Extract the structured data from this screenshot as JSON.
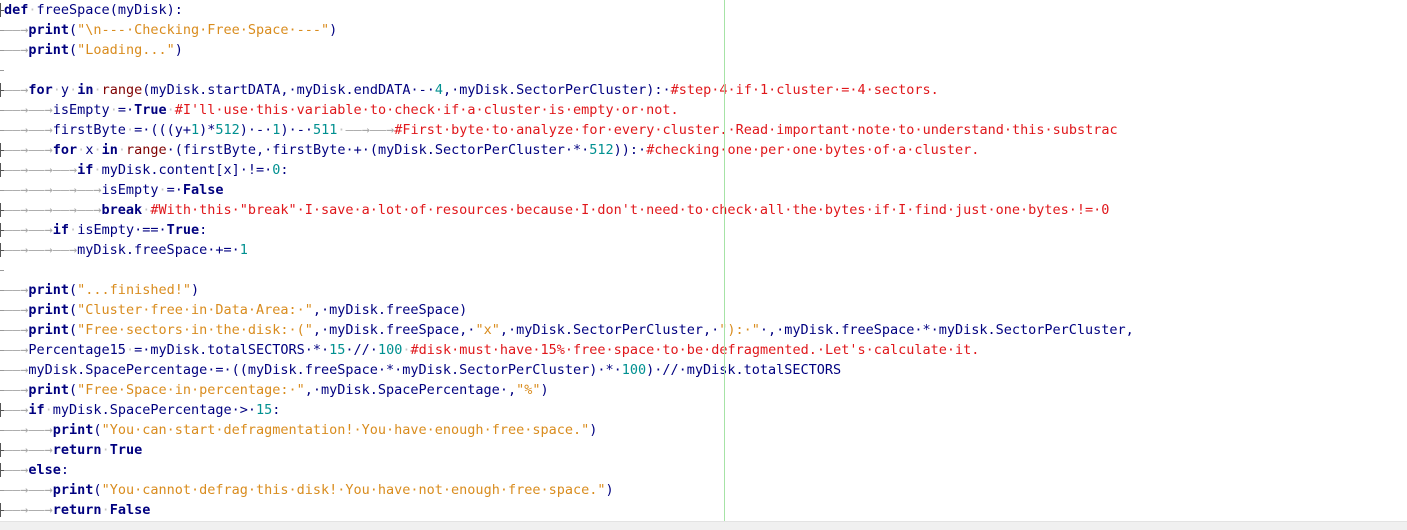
{
  "editor": {
    "language": "python",
    "colors": {
      "background": "#ffffff",
      "keyword": "#00007f",
      "builtin": "#7f0000",
      "string": "#d98c1e",
      "number": "#009090",
      "comment": "#e0171b",
      "identifier": "#000080",
      "whitespace_marker": "#a8a8a8",
      "edge_guide": "#a6e3a6"
    },
    "icons": {
      "fold_marker": "fold-marker-icon",
      "tab_arrow": "tab-arrow-icon"
    },
    "lines": [
      {
        "fold": "fold-start",
        "tokens": [
          {
            "t": "kw",
            "v": "def"
          },
          {
            "t": "ws",
            "v": "·"
          },
          {
            "t": "id",
            "v": "freeSpace"
          },
          {
            "t": "op",
            "v": "(myDisk):"
          }
        ]
      },
      {
        "fold": "fold-line",
        "tokens": [
          {
            "t": "tab",
            "v": "——→"
          },
          {
            "t": "kw",
            "v": "print"
          },
          {
            "t": "op",
            "v": "("
          },
          {
            "t": "str",
            "v": "\"\\n---·Checking·Free·Space·---\""
          },
          {
            "t": "op",
            "v": ")"
          }
        ]
      },
      {
        "fold": "fold-line",
        "tokens": [
          {
            "t": "tab",
            "v": "——→"
          },
          {
            "t": "kw",
            "v": "print"
          },
          {
            "t": "op",
            "v": "("
          },
          {
            "t": "str",
            "v": "\"Loading...\""
          },
          {
            "t": "op",
            "v": ")"
          }
        ]
      },
      {
        "fold": "fold-line",
        "tokens": []
      },
      {
        "fold": "fold-sub",
        "tokens": [
          {
            "t": "tab",
            "v": "——→"
          },
          {
            "t": "kw",
            "v": "for"
          },
          {
            "t": "ws",
            "v": "·"
          },
          {
            "t": "id",
            "v": "y"
          },
          {
            "t": "ws",
            "v": "·"
          },
          {
            "t": "kw",
            "v": "in"
          },
          {
            "t": "ws",
            "v": "·"
          },
          {
            "t": "bi",
            "v": "range"
          },
          {
            "t": "op",
            "v": "(myDisk.startDATA,·myDisk.endDATA·-·"
          },
          {
            "t": "num",
            "v": "4"
          },
          {
            "t": "op",
            "v": ",·myDisk.SectorPerCluster):·"
          },
          {
            "t": "cmt",
            "v": "#step·4·if·1·cluster·=·4·sectors."
          }
        ]
      },
      {
        "fold": "fold-line",
        "tokens": [
          {
            "t": "tab",
            "v": "——→——→"
          },
          {
            "t": "id",
            "v": "isEmpty"
          },
          {
            "t": "ws",
            "v": "·"
          },
          {
            "t": "op",
            "v": "=·"
          },
          {
            "t": "kw",
            "v": "True"
          },
          {
            "t": "ws",
            "v": "·"
          },
          {
            "t": "cmt",
            "v": "#I'll·use·this·variable·to·check·if·a·cluster·is·empty·or·not."
          }
        ]
      },
      {
        "fold": "fold-line",
        "tokens": [
          {
            "t": "tab",
            "v": "——→——→"
          },
          {
            "t": "id",
            "v": "firstByte"
          },
          {
            "t": "ws",
            "v": "·"
          },
          {
            "t": "op",
            "v": "=·(((y+"
          },
          {
            "t": "num",
            "v": "1"
          },
          {
            "t": "op",
            "v": ")*"
          },
          {
            "t": "num",
            "v": "512"
          },
          {
            "t": "op",
            "v": ")·-·"
          },
          {
            "t": "num",
            "v": "1"
          },
          {
            "t": "op",
            "v": ")·-·"
          },
          {
            "t": "num",
            "v": "511"
          },
          {
            "t": "ws",
            "v": "·"
          },
          {
            "t": "tab",
            "v": "——→——→"
          },
          {
            "t": "cmt",
            "v": "#First·byte·to·analyze·for·every·cluster.·Read·important·note·to·understand·this·substrac"
          }
        ]
      },
      {
        "fold": "fold-sub",
        "tokens": [
          {
            "t": "tab",
            "v": "——→——→"
          },
          {
            "t": "kw",
            "v": "for"
          },
          {
            "t": "ws",
            "v": "·"
          },
          {
            "t": "id",
            "v": "x"
          },
          {
            "t": "ws",
            "v": "·"
          },
          {
            "t": "kw",
            "v": "in"
          },
          {
            "t": "ws",
            "v": "·"
          },
          {
            "t": "bi",
            "v": "range"
          },
          {
            "t": "op",
            "v": "·(firstByte,·firstByte·+·(myDisk.SectorPerCluster·*·"
          },
          {
            "t": "num",
            "v": "512"
          },
          {
            "t": "op",
            "v": ")):·"
          },
          {
            "t": "cmt",
            "v": "#checking·one·per·one·bytes·of·a·cluster."
          }
        ]
      },
      {
        "fold": "fold-sub",
        "tokens": [
          {
            "t": "tab",
            "v": "——→——→——→"
          },
          {
            "t": "kw",
            "v": "if"
          },
          {
            "t": "ws",
            "v": "·"
          },
          {
            "t": "op",
            "v": "myDisk.content[x]·!=·"
          },
          {
            "t": "num",
            "v": "0"
          },
          {
            "t": "op",
            "v": ":"
          }
        ]
      },
      {
        "fold": "fold-line",
        "tokens": [
          {
            "t": "tab",
            "v": "——→——→——→——→"
          },
          {
            "t": "id",
            "v": "isEmpty"
          },
          {
            "t": "ws",
            "v": "·"
          },
          {
            "t": "op",
            "v": "=·"
          },
          {
            "t": "kw",
            "v": "False"
          }
        ]
      },
      {
        "fold": "fold-end",
        "tokens": [
          {
            "t": "tab",
            "v": "——→——→——→——→"
          },
          {
            "t": "kw",
            "v": "break"
          },
          {
            "t": "ws",
            "v": "·"
          },
          {
            "t": "cmt",
            "v": "#With·this·\"break\"·I·save·a·lot·of·resources·because·I·don't·need·to·check·all·the·bytes·if·I·find·just·one·bytes·!=·0"
          }
        ]
      },
      {
        "fold": "fold-sub",
        "tokens": [
          {
            "t": "tab",
            "v": "——→——→"
          },
          {
            "t": "kw",
            "v": "if"
          },
          {
            "t": "ws",
            "v": "·"
          },
          {
            "t": "op",
            "v": "isEmpty·==·"
          },
          {
            "t": "kw",
            "v": "True"
          },
          {
            "t": "op",
            "v": ":"
          }
        ]
      },
      {
        "fold": "fold-end",
        "tokens": [
          {
            "t": "tab",
            "v": "——→——→——→"
          },
          {
            "t": "op",
            "v": "myDisk.freeSpace·+=·"
          },
          {
            "t": "num",
            "v": "1"
          }
        ]
      },
      {
        "fold": "fold-line",
        "tokens": []
      },
      {
        "fold": "fold-line",
        "tokens": [
          {
            "t": "tab",
            "v": "——→"
          },
          {
            "t": "kw",
            "v": "print"
          },
          {
            "t": "op",
            "v": "("
          },
          {
            "t": "str",
            "v": "\"...finished!\""
          },
          {
            "t": "op",
            "v": ")"
          }
        ]
      },
      {
        "fold": "fold-line",
        "tokens": [
          {
            "t": "tab",
            "v": "——→"
          },
          {
            "t": "kw",
            "v": "print"
          },
          {
            "t": "op",
            "v": "("
          },
          {
            "t": "str",
            "v": "\"Cluster·free·in·Data·Area:·\""
          },
          {
            "t": "op",
            "v": ",·myDisk.freeSpace)"
          }
        ]
      },
      {
        "fold": "fold-line",
        "tokens": [
          {
            "t": "tab",
            "v": "——→"
          },
          {
            "t": "kw",
            "v": "print"
          },
          {
            "t": "op",
            "v": "("
          },
          {
            "t": "str",
            "v": "\"Free·sectors·in·the·disk:·(\""
          },
          {
            "t": "op",
            "v": ",·myDisk.freeSpace,·"
          },
          {
            "t": "str",
            "v": "\"x\""
          },
          {
            "t": "op",
            "v": ",·myDisk.SectorPerCluster,·"
          },
          {
            "t": "str",
            "v": "\"):·\""
          },
          {
            "t": "op",
            "v": "·,·myDisk.freeSpace·*·myDisk.SectorPerCluster,"
          }
        ]
      },
      {
        "fold": "fold-line",
        "tokens": [
          {
            "t": "tab",
            "v": "——→"
          },
          {
            "t": "id",
            "v": "Percentage15"
          },
          {
            "t": "ws",
            "v": "·"
          },
          {
            "t": "op",
            "v": "=·myDisk.totalSECTORS·*·"
          },
          {
            "t": "num",
            "v": "15"
          },
          {
            "t": "op",
            "v": "·//·"
          },
          {
            "t": "num",
            "v": "100"
          },
          {
            "t": "ws",
            "v": "·"
          },
          {
            "t": "cmt",
            "v": "#disk·must·have·15%·free·space·to·be·defragmented.·Let's·calculate·it."
          }
        ]
      },
      {
        "fold": "fold-line",
        "tokens": [
          {
            "t": "tab",
            "v": "——→"
          },
          {
            "t": "op",
            "v": "myDisk.SpacePercentage·=·((myDisk.freeSpace·*·myDisk.SectorPerCluster)·*·"
          },
          {
            "t": "num",
            "v": "100"
          },
          {
            "t": "op",
            "v": ")·//·myDisk.totalSECTORS"
          }
        ]
      },
      {
        "fold": "fold-line",
        "tokens": [
          {
            "t": "tab",
            "v": "——→"
          },
          {
            "t": "kw",
            "v": "print"
          },
          {
            "t": "op",
            "v": "("
          },
          {
            "t": "str",
            "v": "\"Free·Space·in·percentage:·\""
          },
          {
            "t": "op",
            "v": ",·myDisk.SpacePercentage·,"
          },
          {
            "t": "str",
            "v": "\"%\""
          },
          {
            "t": "op",
            "v": ")"
          }
        ]
      },
      {
        "fold": "fold-sub",
        "tokens": [
          {
            "t": "tab",
            "v": "——→"
          },
          {
            "t": "kw",
            "v": "if"
          },
          {
            "t": "ws",
            "v": "·"
          },
          {
            "t": "op",
            "v": "myDisk.SpacePercentage·>·"
          },
          {
            "t": "num",
            "v": "15"
          },
          {
            "t": "op",
            "v": ":"
          }
        ]
      },
      {
        "fold": "fold-line",
        "tokens": [
          {
            "t": "tab",
            "v": "——→——→"
          },
          {
            "t": "kw",
            "v": "print"
          },
          {
            "t": "op",
            "v": "("
          },
          {
            "t": "str",
            "v": "\"You·can·start·defragmentation!·You·have·enough·free·space.\""
          },
          {
            "t": "op",
            "v": ")"
          }
        ]
      },
      {
        "fold": "fold-end",
        "tokens": [
          {
            "t": "tab",
            "v": "——→——→"
          },
          {
            "t": "kw",
            "v": "return"
          },
          {
            "t": "ws",
            "v": "·"
          },
          {
            "t": "kw",
            "v": "True"
          }
        ]
      },
      {
        "fold": "fold-sub",
        "tokens": [
          {
            "t": "tab",
            "v": "——→"
          },
          {
            "t": "kw",
            "v": "else"
          },
          {
            "t": "op",
            "v": ":"
          }
        ]
      },
      {
        "fold": "fold-line",
        "tokens": [
          {
            "t": "tab",
            "v": "——→——→"
          },
          {
            "t": "kw",
            "v": "print"
          },
          {
            "t": "op",
            "v": "("
          },
          {
            "t": "str",
            "v": "\"You·cannot·defrag·this·disk!·You·have·not·enough·free·space.\""
          },
          {
            "t": "op",
            "v": ")"
          }
        ]
      },
      {
        "fold": "fold-end",
        "tokens": [
          {
            "t": "tab",
            "v": "——→——→"
          },
          {
            "t": "kw",
            "v": "return"
          },
          {
            "t": "ws",
            "v": "·"
          },
          {
            "t": "kw",
            "v": "False"
          }
        ]
      }
    ]
  }
}
